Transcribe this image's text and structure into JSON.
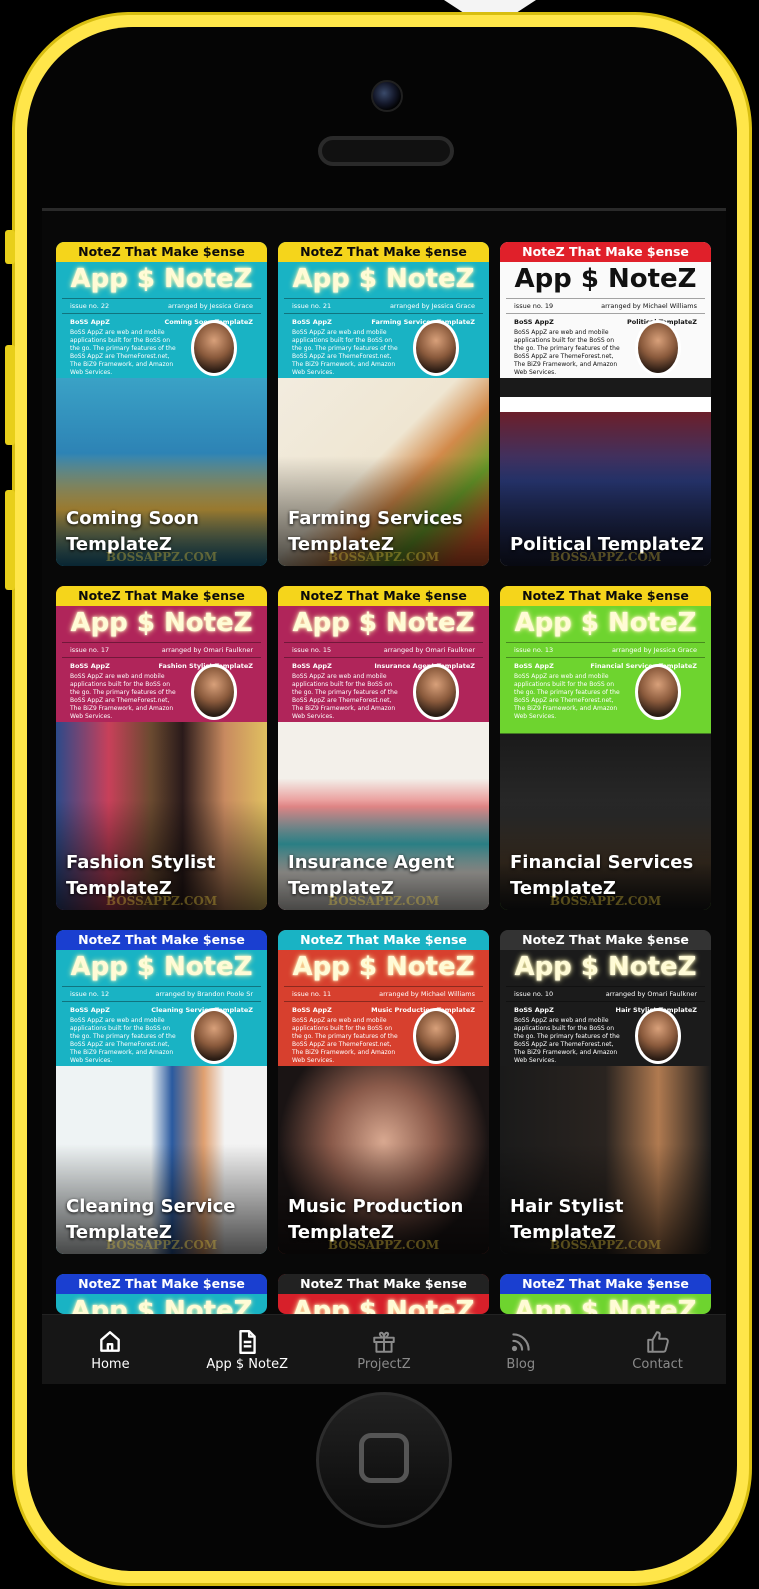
{
  "cards": [
    {
      "band": "NoteZ That Make $ense",
      "title": "App $ NoteZ",
      "issue": "issue no. 22",
      "author": "arranged by Jessica Grace",
      "brand": "BoSS AppZ",
      "template": "Coming Soon TemplateZ",
      "desc": "BoSS AppZ are web and mobile applications built for the BoSS on the go. The primary features of the BoSS AppZ are ThemeForest.net, The BiZ9 Framework, and Amazon Web Services.",
      "caption": "Coming Soon TemplateZ",
      "watermark": "BOSSAPPZ.COM",
      "bandColor": "#f5d51b",
      "bg": "#19b3c4"
    },
    {
      "band": "NoteZ That Make $ense",
      "title": "App $ NoteZ",
      "issue": "issue no. 21",
      "author": "arranged by Jessica Grace",
      "brand": "BoSS AppZ",
      "template": "Farming Services TemplateZ",
      "desc": "BoSS AppZ are web and mobile applications built for the BoSS on the go. The primary features of the BoSS AppZ are ThemeForest.net, The BiZ9 Framework, and Amazon Web Services.",
      "caption": "Farming Services TemplateZ",
      "watermark": "BOSSAPPZ.COM",
      "bandColor": "#f5d51b",
      "bg": "#19b3c4"
    },
    {
      "band": "NoteZ That Make $ense",
      "title": "App $ NoteZ",
      "issue": "issue no. 19",
      "author": "arranged by Michael Williams",
      "brand": "BoSS AppZ",
      "template": "Political TemplateZ",
      "desc": "BoSS AppZ are web and mobile applications built for the BoSS on the go. The primary features of the BoSS AppZ are ThemeForest.net, The BiZ9 Framework, and Amazon Web Services.",
      "caption": "Political TemplateZ",
      "watermark": "BOSSAPPZ.COM",
      "bandColor": "#e0202a",
      "bg": "#fafafa"
    },
    {
      "band": "NoteZ That Make $ense",
      "title": "App $ NoteZ",
      "issue": "issue no. 17",
      "author": "arranged by Omari Faulkner",
      "brand": "BoSS AppZ",
      "template": "Fashion Stylist TemplateZ",
      "desc": "BoSS AppZ are web and mobile applications built for the BoSS on the go. The primary features of the BoSS AppZ are ThemeForest.net, The BiZ9 Framework, and Amazon Web Services.",
      "caption": "Fashion Stylist TemplateZ",
      "watermark": "BOSSAPPZ.COM",
      "bandColor": "#f5d51b",
      "bg": "#b0255a"
    },
    {
      "band": "NoteZ That Make $ense",
      "title": "App $ NoteZ",
      "issue": "issue no. 15",
      "author": "arranged by Omari Faulkner",
      "brand": "BoSS AppZ",
      "template": "Insurance Agent TemplateZ",
      "desc": "BoSS AppZ are web and mobile applications built for the BoSS on the go. The primary features of the BoSS AppZ are ThemeForest.net, The BiZ9 Framework, and Amazon Web Services.",
      "caption": "Insurance Agent TemplateZ",
      "watermark": "BOSSAPPZ.COM",
      "bandColor": "#f5d51b",
      "bg": "#b0255a"
    },
    {
      "band": "NoteZ That Make $ense",
      "title": "App $ NoteZ",
      "issue": "issue no. 13",
      "author": "arranged by Jessica Grace",
      "brand": "BoSS AppZ",
      "template": "Financial Services TemplateZ",
      "desc": "BoSS AppZ are web and mobile applications built for the BoSS on the go. The primary features of the BoSS AppZ are ThemeForest.net, The BiZ9 Framework, and Amazon Web Services.",
      "caption": "Financial Services TemplateZ",
      "watermark": "BOSSAPPZ.COM",
      "bandColor": "#f5d51b",
      "bg": "#6ed42f"
    },
    {
      "band": "NoteZ That Make $ense",
      "title": "App $ NoteZ",
      "issue": "issue no. 12",
      "author": "arranged by Brandon Poole Sr",
      "brand": "BoSS AppZ",
      "template": "Cleaning Service TemplateZ",
      "desc": "BoSS AppZ are web and mobile applications built for the BoSS on the go. The primary features of the BoSS AppZ are ThemeForest.net, The BiZ9 Framework, and Amazon Web Services.",
      "caption": "Cleaning Service TemplateZ",
      "watermark": "BOSSAPPZ.COM",
      "bandColor": "#1a3fd0",
      "bg": "#19b3c4"
    },
    {
      "band": "NoteZ That Make $ense",
      "title": "App $ NoteZ",
      "issue": "issue no. 11",
      "author": "arranged by Michael Williams",
      "brand": "BoSS AppZ",
      "template": "Music Production TemplateZ",
      "desc": "BoSS AppZ are web and mobile applications built for the BoSS on the go. The primary features of the BoSS AppZ are ThemeForest.net, The BiZ9 Framework, and Amazon Web Services.",
      "caption": "Music Production TemplateZ",
      "watermark": "BOSSAPPZ.COM",
      "bandColor": "#19b3c4",
      "bg": "#d7402e"
    },
    {
      "band": "NoteZ That Make $ense",
      "title": "App $ NoteZ",
      "issue": "issue no. 10",
      "author": "arranged by Omari Faulkner",
      "brand": "BoSS AppZ",
      "template": "Hair Stylist TemplateZ",
      "desc": "BoSS AppZ are web and mobile applications built for the BoSS on the go. The primary features of the BoSS AppZ are ThemeForest.net, The BiZ9 Framework, and Amazon Web Services.",
      "caption": "Hair Stylist TemplateZ",
      "watermark": "BOSSAPPZ.COM",
      "bandColor": "#333333",
      "bg": "#1b1b1b"
    }
  ],
  "partials": [
    {
      "band": "NoteZ That Make $ense",
      "title": "App $ NoteZ",
      "bandColor": "#1a3fd0",
      "bg": "#19b3c4"
    },
    {
      "band": "NoteZ That Make $ense",
      "title": "App $ NoteZ",
      "bandColor": "#222222",
      "bg": "#d7202a"
    },
    {
      "band": "NoteZ That Make $ense",
      "title": "App $ NoteZ",
      "bandColor": "#1a3fd0",
      "bg": "#6ed42f"
    }
  ],
  "tabs": [
    {
      "label": "Home",
      "icon": "home-icon",
      "active": true
    },
    {
      "label": "App $ NoteZ",
      "icon": "document-icon",
      "active": true
    },
    {
      "label": "ProjectZ",
      "icon": "gift-icon",
      "active": false
    },
    {
      "label": "Blog",
      "icon": "rss-icon",
      "active": false
    },
    {
      "label": "Contact",
      "icon": "thumbs-up-icon",
      "active": false
    }
  ],
  "colors": {
    "frame": "#ffe64a",
    "tab_active": "#ffffff",
    "tab_inactive": "#8a8a8a"
  }
}
